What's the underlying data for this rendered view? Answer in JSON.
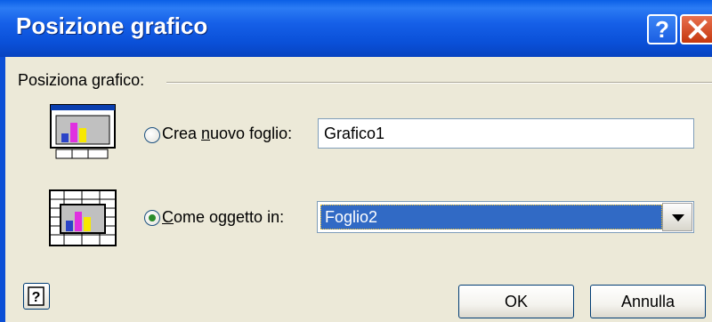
{
  "dialog": {
    "title": "Posizione grafico",
    "group_label": "Posiziona grafico:",
    "new_sheet": {
      "label_prefix": "Crea ",
      "label_accel": "n",
      "label_suffix": "uovo foglio:",
      "value": "Grafico1",
      "selected": false
    },
    "as_object": {
      "label_prefix": "",
      "label_accel": "C",
      "label_suffix": "ome oggetto in:",
      "value": "Foglio2",
      "selected": true
    },
    "ok_label": "OK",
    "cancel_label": "Annulla"
  },
  "colors": {
    "titlebar": "#0a50d8",
    "selection": "#316ac5",
    "chart_bar_blue": "#2b44c8",
    "chart_bar_magenta": "#e030e0",
    "chart_bar_yellow": "#f8e800"
  },
  "icons": [
    "help-icon",
    "close-icon",
    "new-sheet-chart-icon",
    "embedded-chart-icon",
    "context-help-icon",
    "dropdown-arrow-icon"
  ]
}
